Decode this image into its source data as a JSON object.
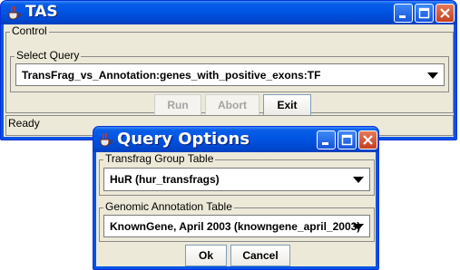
{
  "main_window": {
    "title": "TAS",
    "control_group_label": "Control",
    "select_query_label": "Select Query",
    "selected_query": "TransFrag_vs_Annotation:genes_with_positive_exons:TF",
    "buttons": {
      "run": "Run",
      "abort": "Abort",
      "exit": "Exit"
    },
    "status": "Ready"
  },
  "dialog": {
    "title": "Query Options",
    "group_table_label": "Transfrag Group Table",
    "group_table_value": "HuR (hur_transfrags)",
    "annotation_table_label": "Genomic Annotation Table",
    "annotation_table_value": "KnownGene, April 2003 (knowngene_april_2003)",
    "buttons": {
      "ok": "Ok",
      "cancel": "Cancel"
    }
  },
  "colors": {
    "titlebar_blue": "#0054e3",
    "window_face": "#ece9d8",
    "close_red": "#c5401f"
  },
  "icons": [
    "java-cup-icon",
    "minimize-icon",
    "maximize-icon",
    "close-icon",
    "dropdown-arrow-icon"
  ]
}
